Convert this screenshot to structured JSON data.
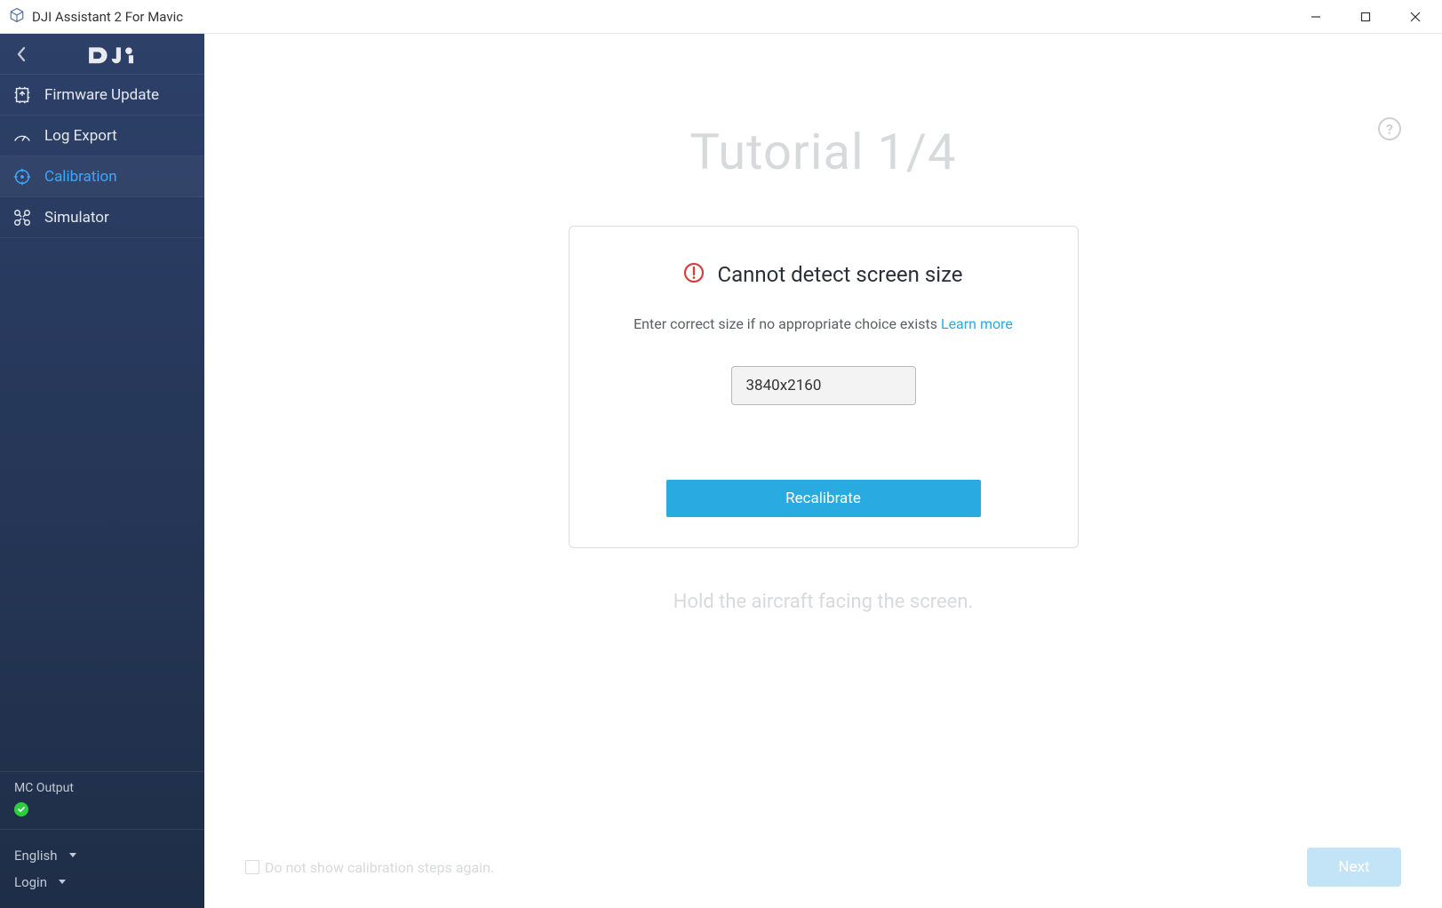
{
  "window": {
    "title": "DJI Assistant 2 For Mavic"
  },
  "sidebar": {
    "items": [
      {
        "label": "Firmware Update"
      },
      {
        "label": "Log Export"
      },
      {
        "label": "Calibration"
      },
      {
        "label": "Simulator"
      }
    ],
    "mc_output": "MC Output",
    "language": "English",
    "login": "Login"
  },
  "main": {
    "tutorial_title": "Tutorial 1/4",
    "card": {
      "title": "Cannot detect screen size",
      "subtitle": "Enter correct size if no appropriate choice exists ",
      "learn_more": "Learn more",
      "input_value": "3840x2160",
      "recalibrate": "Recalibrate"
    },
    "instruction": "Hold the aircraft facing the screen.",
    "footer": {
      "checkbox_label": "Do not show calibration steps again.",
      "next": "Next"
    }
  }
}
